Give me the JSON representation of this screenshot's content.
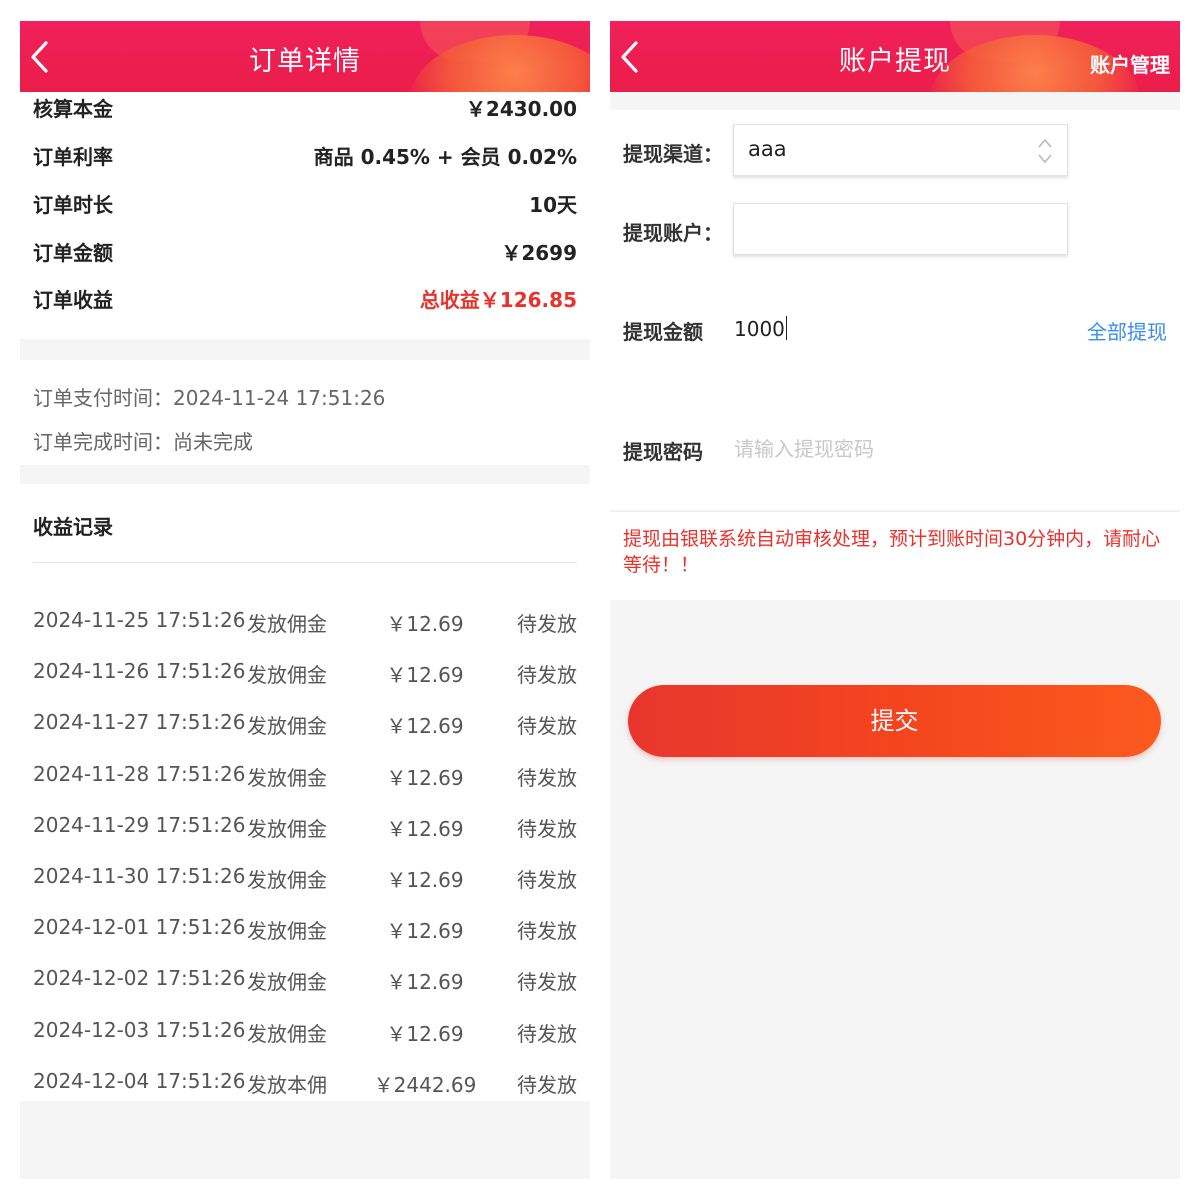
{
  "left": {
    "header": {
      "title": "订单详情"
    },
    "summary": [
      {
        "label": "核算本金",
        "value": "￥2430.00"
      },
      {
        "label": "订单利率",
        "value": "商品 0.45% + 会员 0.02%"
      },
      {
        "label": "订单时长",
        "value": "10天"
      },
      {
        "label": "订单金额",
        "value": "￥2699"
      },
      {
        "label": "订单收益",
        "value": "总收益￥126.85"
      }
    ],
    "times": {
      "pay_time": "订单支付时间：2024-11-24 17:51:26",
      "complete_time": "订单完成时间：尚未完成"
    },
    "records": {
      "title": "收益记录",
      "rows": [
        {
          "date": "2024-11-25 17:51:26",
          "type": "发放佣金",
          "amount": "￥12.69",
          "status": "待发放"
        },
        {
          "date": "2024-11-26 17:51:26",
          "type": "发放佣金",
          "amount": "￥12.69",
          "status": "待发放"
        },
        {
          "date": "2024-11-27 17:51:26",
          "type": "发放佣金",
          "amount": "￥12.69",
          "status": "待发放"
        },
        {
          "date": "2024-11-28 17:51:26",
          "type": "发放佣金",
          "amount": "￥12.69",
          "status": "待发放"
        },
        {
          "date": "2024-11-29 17:51:26",
          "type": "发放佣金",
          "amount": "￥12.69",
          "status": "待发放"
        },
        {
          "date": "2024-11-30 17:51:26",
          "type": "发放佣金",
          "amount": "￥12.69",
          "status": "待发放"
        },
        {
          "date": "2024-12-01 17:51:26",
          "type": "发放佣金",
          "amount": "￥12.69",
          "status": "待发放"
        },
        {
          "date": "2024-12-02 17:51:26",
          "type": "发放佣金",
          "amount": "￥12.69",
          "status": "待发放"
        },
        {
          "date": "2024-12-03 17:51:26",
          "type": "发放佣金",
          "amount": "￥12.69",
          "status": "待发放"
        },
        {
          "date": "2024-12-04 17:51:26",
          "type": "发放本佣",
          "amount": "￥2442.69",
          "status": "待发放"
        }
      ]
    }
  },
  "right": {
    "header": {
      "title": "账户提现",
      "right_link": "账户管理"
    },
    "form": {
      "channel_label": "提现渠道：",
      "channel_value": "aaa",
      "account_label": "提现账户：",
      "account_value": "",
      "amount_label": "提现金额",
      "amount_value": "1000",
      "withdraw_all": "全部提现",
      "password_label": "提现密码",
      "password_placeholder": "请输入提现密码"
    },
    "notice": "提现由银联系统自动审核处理，预计到账时间30分钟内，请耐心等待！！",
    "submit_label": "提交"
  },
  "colors": {
    "header": "#ea1e4a",
    "accent_red": "#e8322c",
    "link_blue": "#3a8ef0",
    "button_gradient_start": "#e8362e",
    "button_gradient_end": "#fb5a1e"
  },
  "icons": [
    "back-arrow-icon",
    "select-updown-icon"
  ]
}
